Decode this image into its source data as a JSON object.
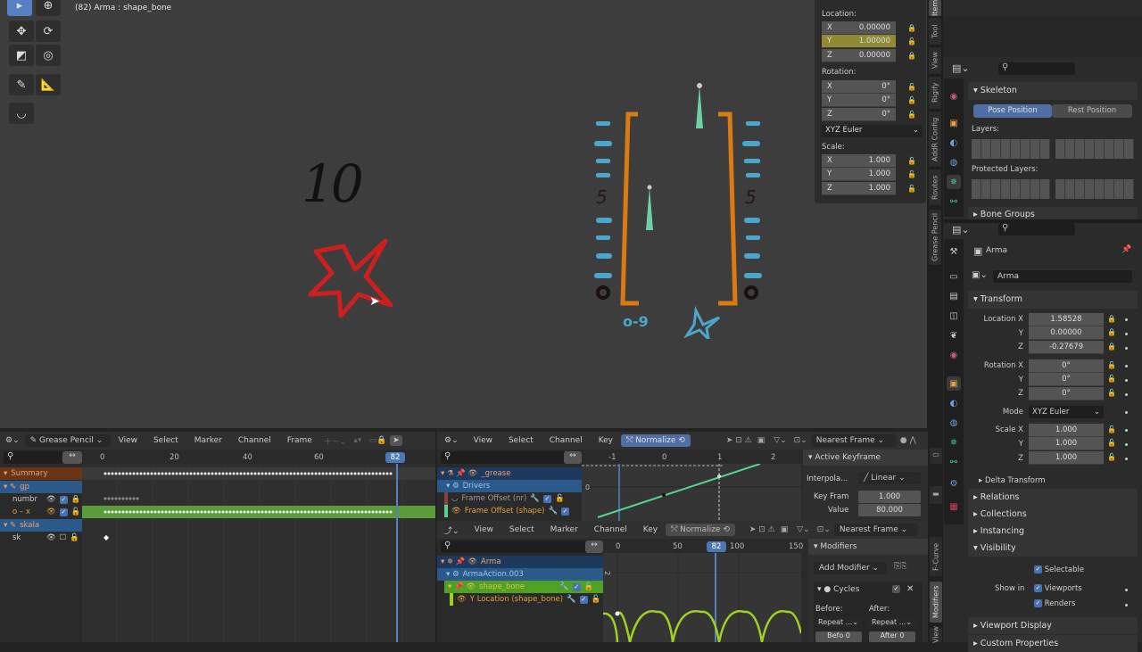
{
  "viewport": {
    "title": "(82) Arma : shape_bone",
    "tools": [
      "select-box-icon",
      "cursor-icon",
      "move-icon",
      "rotate-icon",
      "scale-icon",
      "transform-icon",
      "annotate-icon",
      "measure-icon",
      "bone-roll-icon"
    ],
    "drawing": {
      "number_text": "10",
      "scale_left_label": "5",
      "scale_right_label": "5",
      "zero_left": "0",
      "zero_right": "0",
      "bottom_label": "0-9"
    }
  },
  "npanel": {
    "location_label": "Location:",
    "location": [
      {
        "axis": "X",
        "value": "0.00000",
        "locked": true
      },
      {
        "axis": "Y",
        "value": "1.00000",
        "locked": false
      },
      {
        "axis": "Z",
        "value": "0.00000",
        "locked": true
      }
    ],
    "rotation_label": "Rotation:",
    "rotation": [
      {
        "axis": "X",
        "value": "0°"
      },
      {
        "axis": "Y",
        "value": "0°"
      },
      {
        "axis": "Z",
        "value": "0°"
      }
    ],
    "rotation_mode": "XYZ Euler",
    "scale_label": "Scale:",
    "scale": [
      {
        "axis": "X",
        "value": "1.000"
      },
      {
        "axis": "Y",
        "value": "1.000"
      },
      {
        "axis": "Z",
        "value": "1.000"
      }
    ],
    "tabs": [
      "Item",
      "Tool",
      "View",
      "Rigify",
      "AddR Config",
      "Routes",
      "Grease Pencil"
    ]
  },
  "properties_top": {
    "skeleton_label": "Skeleton",
    "pose_position": "Pose Position",
    "rest_position": "Rest Position",
    "layers_label": "Layers:",
    "protected_layers_label": "Protected Layers:",
    "bone_groups_label": "Bone Groups"
  },
  "properties": {
    "object_name": "Arma",
    "object_field": "Arma",
    "transform_label": "Transform",
    "location_label": "Location X",
    "location": [
      "1.58528",
      "0.00000",
      "-0.27679"
    ],
    "rotation_label": "Rotation X",
    "rotation": [
      "0°",
      "0°",
      "0°"
    ],
    "mode_label": "Mode",
    "mode_value": "XYZ Euler",
    "scale_label": "Scale X",
    "scale": [
      "1.000",
      "1.000",
      "1.000"
    ],
    "axis_y": "Y",
    "axis_z": "Z",
    "delta_transform": "Delta Transform",
    "relations": "Relations",
    "collections": "Collections",
    "instancing": "Instancing",
    "visibility": "Visibility",
    "selectable": "Selectable",
    "show_in": "Show in",
    "viewports": "Viewports",
    "renders": "Renders",
    "viewport_display": "Viewport Display",
    "custom_properties": "Custom Properties"
  },
  "dopesheet": {
    "mode": "Grease Pencil",
    "menus": [
      "View",
      "Select",
      "Marker",
      "Channel",
      "Frame"
    ],
    "ruler": [
      "0",
      "20",
      "40",
      "60"
    ],
    "current_frame": "82",
    "channels": [
      {
        "name": "Summary",
        "type": "summary"
      },
      {
        "name": "gp",
        "type": "object"
      },
      {
        "name": "numbr",
        "type": "layer"
      },
      {
        "name": "o – x",
        "type": "layer-active"
      },
      {
        "name": "skala",
        "type": "object"
      },
      {
        "name": "sk",
        "type": "layer"
      }
    ]
  },
  "drivers": {
    "menus": [
      "View",
      "Select",
      "Channel",
      "Key"
    ],
    "normalize": "Normalize",
    "snap": "Nearest Frame",
    "ruler": [
      "-1",
      "0",
      "1",
      "2"
    ],
    "y_label": "0",
    "channels": [
      {
        "name": "_grease"
      },
      {
        "name": "Drivers"
      },
      {
        "name": "Frame Offset (nr)"
      },
      {
        "name": "Frame Offset (shape)"
      }
    ],
    "active_keyframe_label": "Active Keyframe",
    "interpolation_label": "Interpola...",
    "interpolation_value": "Linear",
    "key_frame_label": "Key Fram",
    "key_frame_value": "1.000",
    "value_label": "Value",
    "value_value": "80.000"
  },
  "graph": {
    "menus": [
      "View",
      "Select",
      "Marker",
      "Channel",
      "Key"
    ],
    "normalize": "Normalize",
    "snap": "Nearest Frame",
    "ruler": [
      "0",
      "50",
      "100",
      "150"
    ],
    "current_frame": "82",
    "y_label": "2",
    "channels": [
      {
        "name": "Arma"
      },
      {
        "name": "ArmaAction.003"
      },
      {
        "name": "shape_bone"
      },
      {
        "name": "Y Location (shape_bone)"
      }
    ],
    "modifiers_label": "Modifiers",
    "add_modifier": "Add Modifier",
    "cycles_label": "Cycles",
    "before_label": "Before:",
    "after_label": "After:",
    "before_mode": "Repeat ...",
    "after_mode": "Repeat ...",
    "before_count": "Befo  0",
    "after_count": "After  0",
    "side_tabs": [
      "F-Curve",
      "Modifiers",
      "View"
    ]
  }
}
